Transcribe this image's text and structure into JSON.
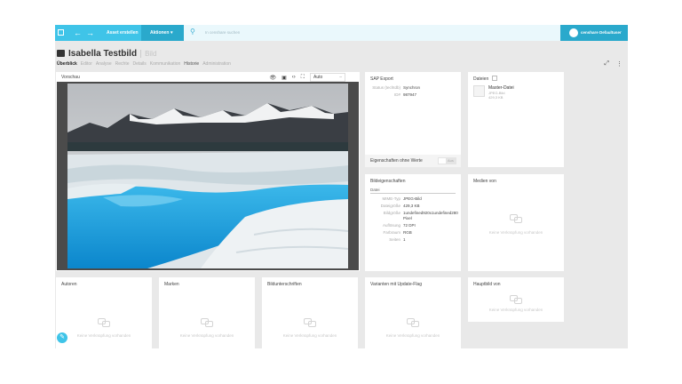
{
  "topbar": {
    "back_icon": "arrow-left-icon",
    "forward_icon": "arrow-right-icon",
    "create_asset": "Asset erstellen",
    "actions": "Aktionen",
    "search_placeholder": "In censhare suchen",
    "user_name": "censhare Defaultuser",
    "accent_color": "#3fc4e8"
  },
  "header": {
    "title": "Isabella Testbild",
    "type": "Bild",
    "tabs": [
      "Überblick",
      "Editor",
      "Analyse",
      "Rechte",
      "Details",
      "Kommunikation",
      "Historie",
      "Administration"
    ]
  },
  "preview": {
    "title": "Vorschau",
    "zoom": "Auto"
  },
  "sap": {
    "title": "SAP Export",
    "rows": [
      {
        "key": "Status (techtdb)",
        "value": "Synchron"
      },
      {
        "key": "ID#",
        "value": "987947"
      }
    ]
  },
  "properties_no_value": {
    "title": "Eigenschaften ohne Werte",
    "toggle_label": "Aus"
  },
  "files": {
    "title": "Dateien",
    "master_name": "Master-Datei",
    "master_type": "JPEG-Bild",
    "master_size": "429,3 KB"
  },
  "image_props": {
    "title": "Bildeigenschaften",
    "section": "Datei",
    "rows": [
      {
        "key": "MIME-Typ",
        "value": "JPEG-Bild"
      },
      {
        "key": "Dateigröße",
        "value": "429,3 KB"
      },
      {
        "key": "Bildgröße",
        "value": "1undefined920x1undefined280 Pixel"
      },
      {
        "key": "Auflösung",
        "value": "72 DPI"
      },
      {
        "key": "Farbraum",
        "value": "RGB"
      },
      {
        "key": "Seiten",
        "value": "1"
      }
    ]
  },
  "empty_text": "Keine Verknüpfung vorhanden",
  "media_of": {
    "title": "Medien von"
  },
  "main_image_of": {
    "title": "Hauptbild von"
  },
  "bottom_panels": [
    {
      "title": "Autoren"
    },
    {
      "title": "Marken"
    },
    {
      "title": "Bildunterschriften"
    },
    {
      "title": "Varianten mit Update-Flag"
    }
  ]
}
